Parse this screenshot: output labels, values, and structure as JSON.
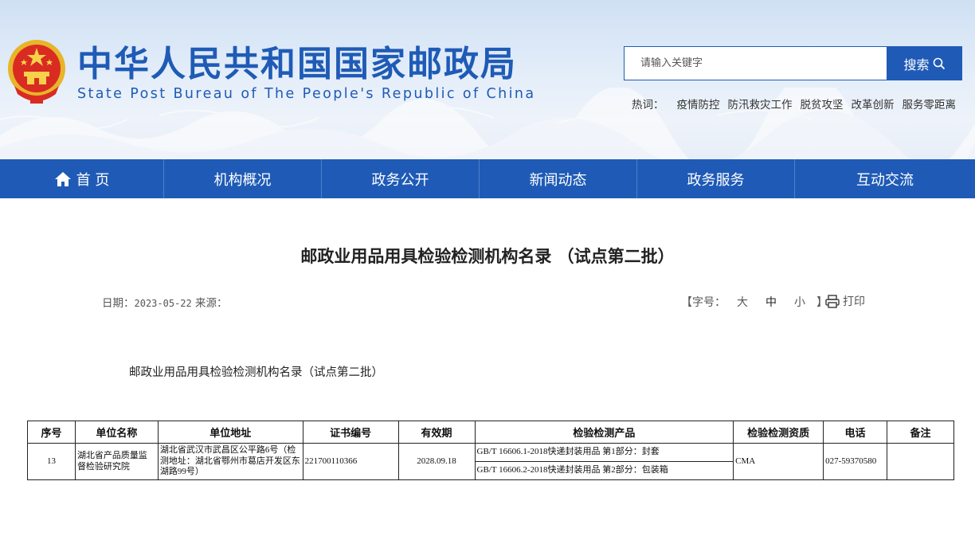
{
  "header": {
    "title": "中华人民共和国国家邮政局",
    "subtitle": "State Post Bureau of The People's Republic of China",
    "search_placeholder": "请输入关键字",
    "search_button": "搜索",
    "hotwords_label": "热词：",
    "hotwords": [
      "疫情防控",
      "防汛救灾工作",
      "脱贫攻坚",
      "改革创新",
      "服务零距离"
    ],
    "brand_color": "#1f5bb6"
  },
  "nav": {
    "items": [
      "首 页",
      "机构概况",
      "政务公开",
      "新闻动态",
      "政务服务",
      "互动交流"
    ]
  },
  "article": {
    "title": "邮政业用品用具检验检测机构名录 （试点第二批）",
    "date_label": "日期：",
    "date": "2023-05-22",
    "source_label": "来源：",
    "fontsize_prefix": "【字号：",
    "fontsize_options": [
      "大",
      "中",
      "小"
    ],
    "fontsize_suffix": "】",
    "print_label": "打印",
    "subheading": "邮政业用品用具检验检测机构名录（试点第二批）"
  },
  "table": {
    "headers": [
      "序号",
      "单位名称",
      "单位地址",
      "证书编号",
      "有效期",
      "检验检测产品",
      "检验检测资质",
      "电话",
      "备注"
    ],
    "row": {
      "no": "13",
      "name": "湖北省产品质量监督检验研究院",
      "address": "湖北省武汉市武昌区公平路6号（检测地址：湖北省鄂州市葛店开发区东湖路99号）",
      "cert": "221700110366",
      "validity": "2028.09.18",
      "products": [
        "GB/T 16606.1-2018快递封装用品 第1部分：封套",
        "GB/T 16606.2-2018快递封装用品 第2部分：包装箱"
      ],
      "qualification": "CMA",
      "phone": "027-59370580",
      "remark": ""
    }
  }
}
